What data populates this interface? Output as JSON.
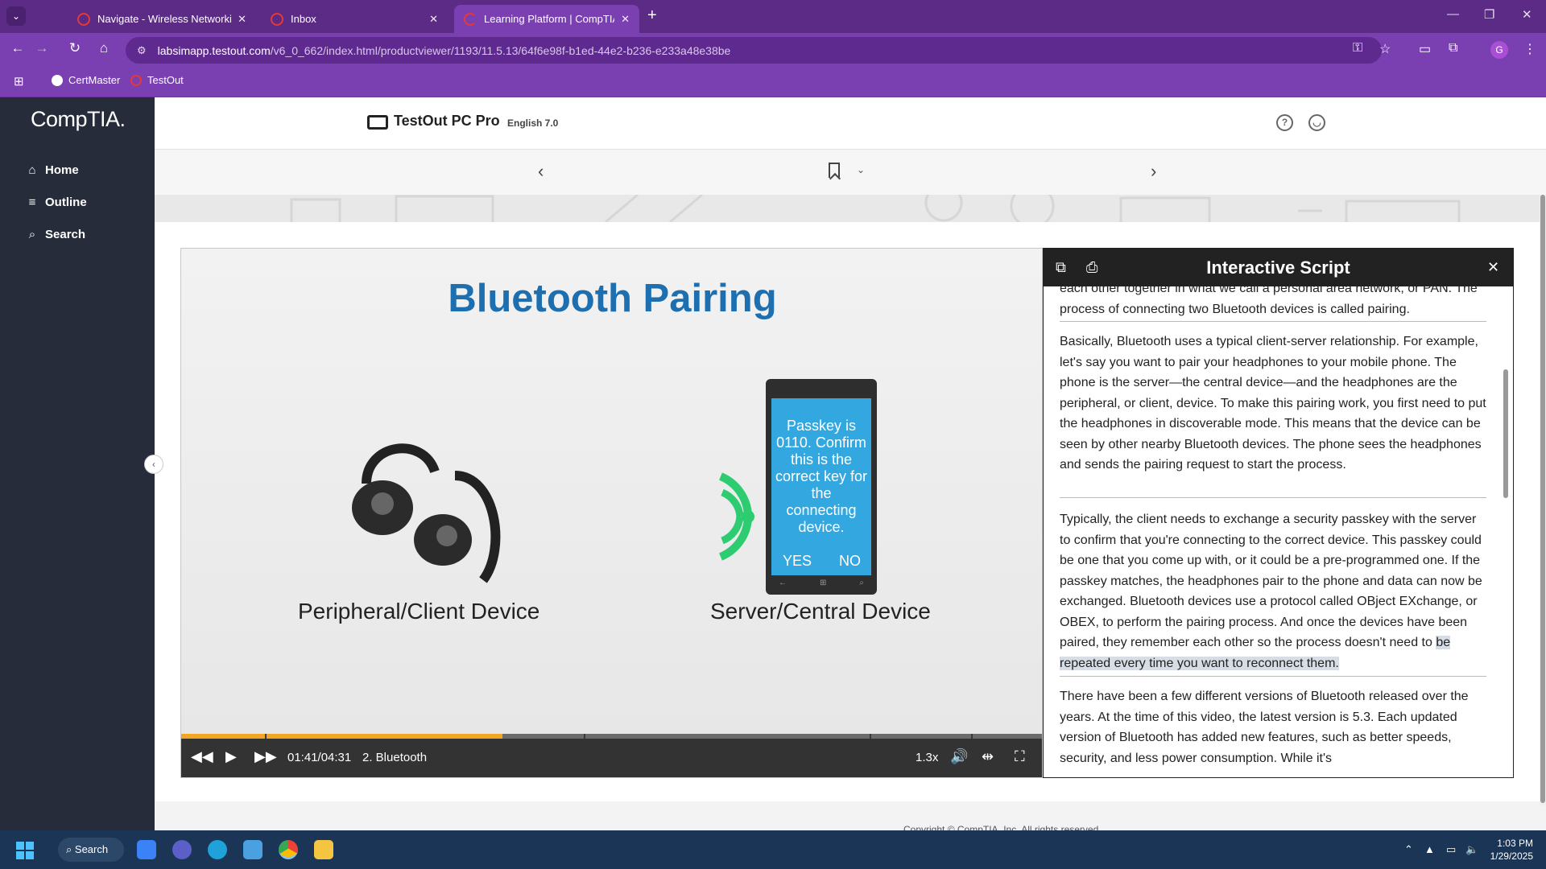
{
  "browser": {
    "tabs": [
      {
        "label": "Navigate - Wireless Networking",
        "close": "✕",
        "color": "#e53935",
        "active": false
      },
      {
        "label": "Inbox",
        "close": "✕",
        "color": "#e53935",
        "active": false
      },
      {
        "label": "Learning Platform | CompTIA",
        "close": "✕",
        "color": "#e53935",
        "active": true
      }
    ],
    "new_tab": "+",
    "url_host": "labsimapp.testout.com",
    "url_path": "/v6_0_662/index.html/productviewer/1193/11.5.13/64f6e98f-b1ed-44e2-b236-e233a48e38be",
    "profile_initial": "G",
    "bookmarks": [
      {
        "label": "CertMaster",
        "color": "#ffffff"
      },
      {
        "label": "TestOut",
        "color": "#e53935"
      }
    ]
  },
  "app": {
    "logo": "CompTIA.",
    "sidebar": [
      {
        "label": "Home",
        "icon": "⌂"
      },
      {
        "label": "Outline",
        "icon": "≡"
      },
      {
        "label": "Search",
        "icon": "⌕"
      }
    ],
    "product_title": "TestOut PC Pro",
    "product_version": "English 7.0",
    "help_icon_text": "?",
    "footer_text": "Copyright © CompTIA, Inc. All rights reserved."
  },
  "video": {
    "slide_title": "Bluetooth Pairing",
    "left_label": "Peripheral/Client Device",
    "right_label": "Server/Central Device",
    "phone_message": "Passkey is 0110. Confirm this is the correct key for the connecting device.",
    "phone_yes": "YES",
    "phone_no": "NO",
    "time": "01:41/04:31",
    "chapter": "2. Bluetooth",
    "speed": "1.3x",
    "progress": 0.373,
    "colors": {
      "title": "#1d6fb0",
      "progress": "#f2a623",
      "phone_screen": "#33a7e0",
      "signal": "#2ecc71"
    }
  },
  "script": {
    "title": "Interactive Script",
    "para0": "each other together in what we call a personal area network, or PAN. The process of connecting two Bluetooth devices is called pairing.",
    "para1": "Basically, Bluetooth uses a typical client-server relationship. For example, let's say you want to pair your headphones to your mobile phone. The phone is the server—the central device—and the headphones are the peripheral, or client, device. To make this pairing work, you first need to put the headphones in discoverable mode. This means that the device can be seen by other nearby Bluetooth devices. The phone sees the headphones and sends the pairing request to start the process.",
    "para2_plain": "Typically, the client needs to exchange a security passkey with the server to confirm that you're connecting to the correct device. This passkey could be one that you come up with, or it could be a pre-programmed one. If the passkey matches, the headphones pair to the phone and data can now be exchanged. Bluetooth devices use a protocol called OBject EXchange, or OBEX, to perform the pairing process. And once the devices have been paired, they remember each other so the process doesn't need to ",
    "para2_highlight": "be repeated every time you want to reconnect them.",
    "para3": "There have been a few different versions of Bluetooth released over the years. At the time of this video, the latest version is 5.3. Each updated version of Bluetooth has added new features, such as better speeds, security, and less power consumption. While it's"
  },
  "taskbar": {
    "search": "Search",
    "time": "1:03 PM",
    "date": "1/29/2025"
  }
}
